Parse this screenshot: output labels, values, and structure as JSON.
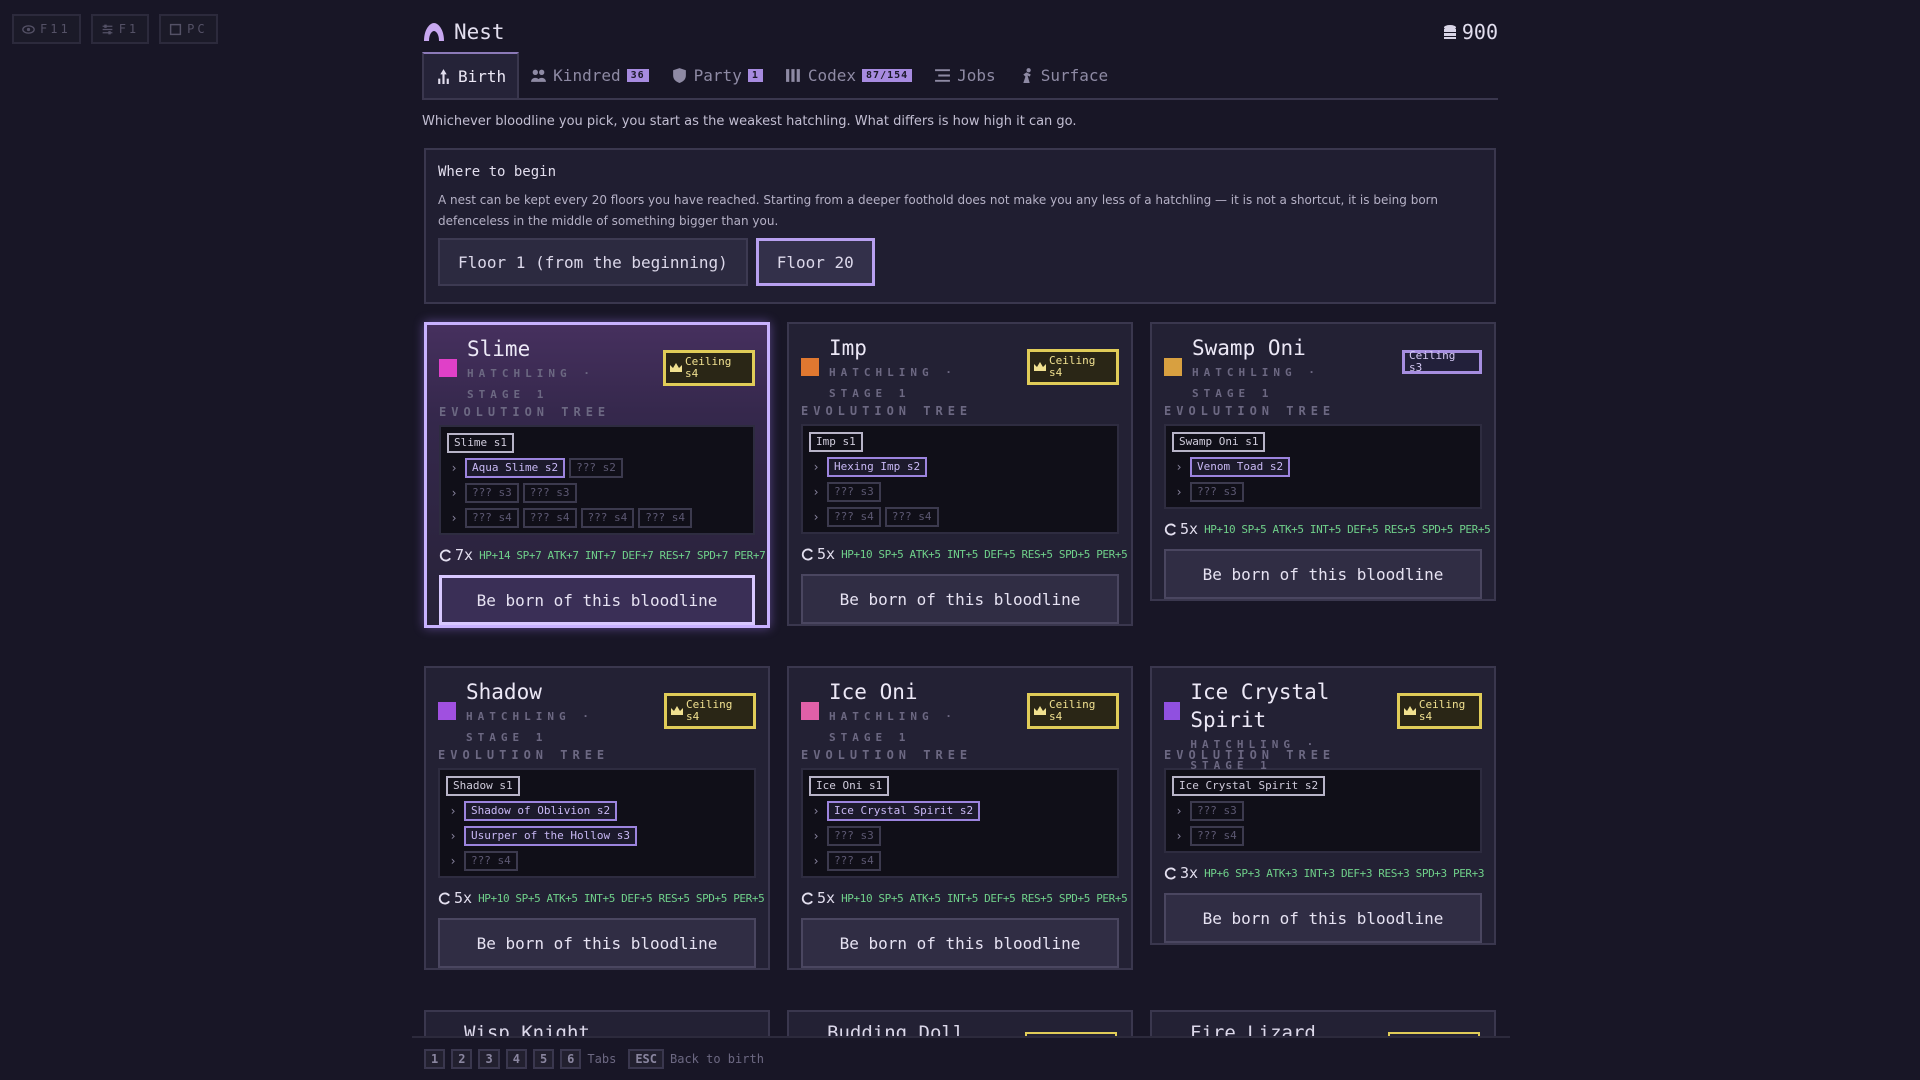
{
  "hotkeys": [
    {
      "label": "F11",
      "icon": "eye-icon"
    },
    {
      "label": "F1",
      "icon": "sliders-icon"
    },
    {
      "label": "PC",
      "icon": "square-icon"
    }
  ],
  "header": {
    "title": "Nest",
    "money": "900"
  },
  "tabs": [
    {
      "label": "Birth",
      "badge": "",
      "active": true
    },
    {
      "label": "Kindred",
      "badge": "36"
    },
    {
      "label": "Party",
      "badge": "1"
    },
    {
      "label": "Codex",
      "badge": "87/154"
    },
    {
      "label": "Jobs",
      "badge": ""
    },
    {
      "label": "Surface",
      "badge": ""
    }
  ],
  "intro": "Whichever bloodline you pick, you start as the weakest hatchling. What differs is how high it can go.",
  "where": {
    "title": "Where to begin",
    "desc": "A nest can be kept every 20 floors you have reached. Starting from a deeper foothold does not make you any less of a hatchling — it is not a shortcut, it is being born defenceless in the middle of something bigger than you.",
    "options": [
      "Floor 1 (from the beginning)",
      "Floor 20"
    ],
    "selected": 1
  },
  "born_label": "Be born of this bloodline",
  "evolution_label": "EVOLUTION TREE",
  "bloodlines": [
    {
      "name": "Slime",
      "stage": "HATCHLING · STAGE 1",
      "color": "#e040c8",
      "ceiling": "Ceiling s4",
      "crown": true,
      "tree": [
        [
          "Slime s1"
        ],
        [
          "Aqua Slime s2",
          "??? s2"
        ],
        [
          "??? s3",
          "??? s3"
        ],
        [
          "??? s4",
          "??? s4",
          "??? s4",
          "??? s4"
        ]
      ],
      "mult": "7x",
      "stats": "HP+14 SP+7 ATK+7 INT+7 DEF+7 RES+7 SPD+7 PER+7"
    },
    {
      "name": "Imp",
      "stage": "HATCHLING · STAGE 1",
      "color": "#e07830",
      "ceiling": "Ceiling s4",
      "crown": true,
      "tree": [
        [
          "Imp s1"
        ],
        [
          "Hexing Imp s2"
        ],
        [
          "??? s3"
        ],
        [
          "??? s4",
          "??? s4"
        ]
      ],
      "mult": "5x",
      "stats": "HP+10 SP+5 ATK+5 INT+5 DEF+5 RES+5 SPD+5 PER+5"
    },
    {
      "name": "Swamp Oni",
      "stage": "HATCHLING · STAGE 1",
      "color": "#d8a040",
      "ceiling": "Ceiling s3",
      "crown": false,
      "tree": [
        [
          "Swamp Oni s1"
        ],
        [
          "Venom Toad s2"
        ],
        [
          "??? s3"
        ]
      ],
      "mult": "5x",
      "stats": "HP+10 SP+5 ATK+5 INT+5 DEF+5 RES+5 SPD+5 PER+5"
    },
    {
      "name": "Shadow",
      "stage": "HATCHLING · STAGE 1",
      "color": "#a050e0",
      "ceiling": "Ceiling s4",
      "crown": true,
      "tree": [
        [
          "Shadow s1"
        ],
        [
          "Shadow of Oblivion s2"
        ],
        [
          "Usurper of the Hollow s3"
        ],
        [
          "??? s4"
        ]
      ],
      "mult": "5x",
      "stats": "HP+10 SP+5 ATK+5 INT+5 DEF+5 RES+5 SPD+5 PER+5"
    },
    {
      "name": "Ice Oni",
      "stage": "HATCHLING · STAGE 1",
      "color": "#e060a8",
      "ceiling": "Ceiling s4",
      "crown": true,
      "tree": [
        [
          "Ice Oni s1"
        ],
        [
          "Ice Crystal Spirit s2"
        ],
        [
          "??? s3"
        ],
        [
          "??? s4"
        ]
      ],
      "mult": "5x",
      "stats": "HP+10 SP+5 ATK+5 INT+5 DEF+5 RES+5 SPD+5 PER+5"
    },
    {
      "name": "Ice Crystal Spirit",
      "stage": "HATCHLING · STAGE 1",
      "color": "#9050e0",
      "ceiling": "Ceiling s4",
      "crown": true,
      "tree": [
        [
          "Ice Crystal Spirit s2"
        ],
        [
          "??? s3"
        ],
        [
          "??? s4"
        ]
      ],
      "mult": "3x",
      "stats": "HP+6 SP+3 ATK+3 INT+3 DEF+3 RES+3 SPD+3 PER+3"
    }
  ],
  "partial_cards": [
    "Wisp Knight",
    "Budding Doll",
    "Fire Lizard"
  ],
  "footer": {
    "keys": [
      "1",
      "2",
      "3",
      "4",
      "5",
      "6"
    ],
    "tabs_label": "Tabs",
    "esc_key": "ESC",
    "esc_label": "Back to birth"
  }
}
